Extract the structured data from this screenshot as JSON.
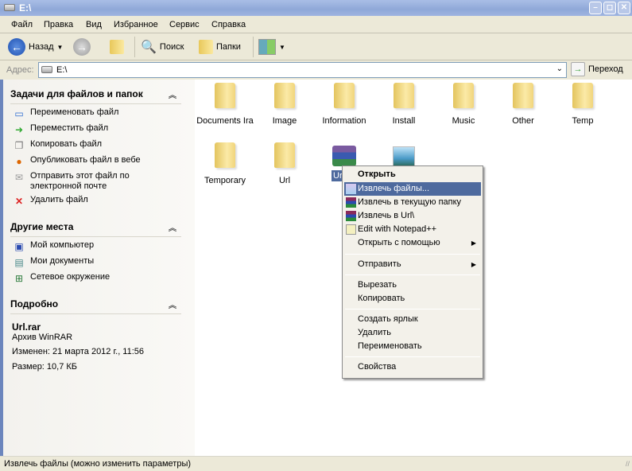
{
  "window": {
    "title": "E:\\"
  },
  "menu": [
    "Файл",
    "Правка",
    "Вид",
    "Избранное",
    "Сервис",
    "Справка"
  ],
  "toolbar": {
    "back": "Назад",
    "search": "Поиск",
    "folders": "Папки"
  },
  "address": {
    "label": "Адрес:",
    "value": "E:\\",
    "go": "Переход"
  },
  "sidebar": {
    "tasks": {
      "title": "Задачи для файлов и папок",
      "items": [
        "Переименовать файл",
        "Переместить файл",
        "Копировать файл",
        "Опубликовать файл в вебе",
        "Отправить этот файл по электронной почте",
        "Удалить файл"
      ]
    },
    "places": {
      "title": "Другие места",
      "items": [
        "Мой компьютер",
        "Мои документы",
        "Сетевое окружение"
      ]
    },
    "details": {
      "title": "Подробно",
      "name": "Url.rar",
      "type": "Архив WinRAR",
      "modified": "Изменен: 21 марта 2012 г., 11:56",
      "size": "Размер: 10,7 КБ"
    }
  },
  "files": [
    "Documents Ira",
    "Image",
    "Information",
    "Install",
    "Music",
    "Other",
    "Temp",
    "Temporary",
    "Url",
    "Url.rar",
    ""
  ],
  "selected_label": "Ur",
  "context_menu": [
    {
      "label": "Открыть",
      "bold": true
    },
    {
      "label": "Извлечь файлы...",
      "highlight": true,
      "icon": "winrar-extract-icon"
    },
    {
      "label": "Извлечь в текущую папку",
      "icon": "winrar-icon"
    },
    {
      "label": "Извлечь в Url\\",
      "icon": "winrar-icon"
    },
    {
      "label": "Edit with Notepad++",
      "icon": "notepadpp-icon"
    },
    {
      "label": "Открыть с помощью",
      "submenu": true
    },
    {
      "sep": true
    },
    {
      "label": "Отправить",
      "submenu": true
    },
    {
      "sep": true
    },
    {
      "label": "Вырезать"
    },
    {
      "label": "Копировать"
    },
    {
      "sep": true
    },
    {
      "label": "Создать ярлык"
    },
    {
      "label": "Удалить"
    },
    {
      "label": "Переименовать"
    },
    {
      "sep": true
    },
    {
      "label": "Свойства"
    }
  ],
  "status": "Извлечь файлы (можно изменить параметры)",
  "colors": {
    "highlight": "#4e6a9e",
    "titlebar": "#9fb4e0",
    "sidebar_border": "#6c86bd"
  }
}
